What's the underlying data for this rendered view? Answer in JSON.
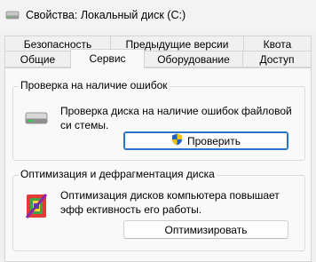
{
  "window": {
    "title": "Свойства: Локальный диск (C:)"
  },
  "tabs": {
    "row1": [
      {
        "label": "Безопасность"
      },
      {
        "label": "Предыдущие версии"
      },
      {
        "label": "Квота"
      }
    ],
    "row2": [
      {
        "label": "Общие"
      },
      {
        "label": "Сервис",
        "active": true
      },
      {
        "label": "Оборудование"
      },
      {
        "label": "Доступ"
      }
    ]
  },
  "error_check": {
    "title": "Проверка на наличие ошибок",
    "description": "Проверка диска на наличие ошибок файловой си стемы.",
    "button_label": "Проверить",
    "icon": "drive-icon",
    "button_icon": "uac-shield-icon"
  },
  "optimize": {
    "title": "Оптимизация и дефрагментация диска",
    "description": "Оптимизация дисков компьютера повышает эфф ективность его работы.",
    "button_label": "Оптимизировать",
    "icon": "defrag-icon"
  },
  "colors": {
    "accent": "#2a73c9"
  }
}
